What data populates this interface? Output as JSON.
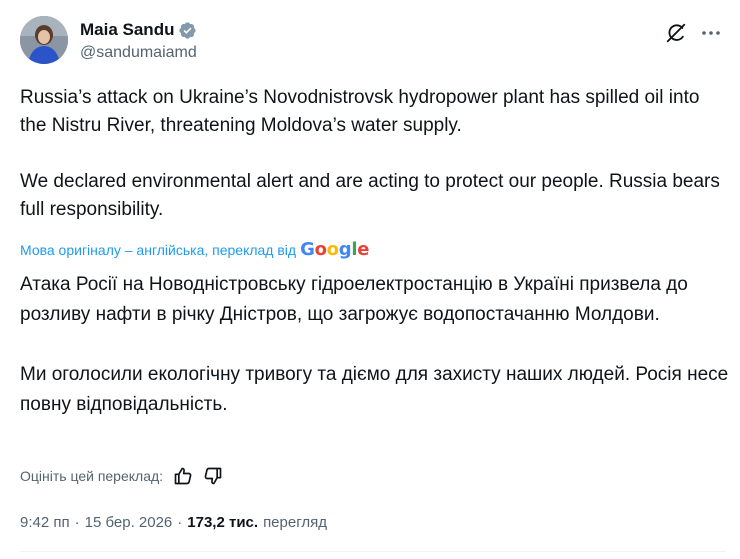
{
  "author": {
    "display_name": "Maia Sandu",
    "handle": "@sandumaiamd",
    "verified": true
  },
  "tweet": {
    "paragraphs": [
      "Russia’s attack on Ukraine’s Novodnistrovsk hydropower plant has spilled oil into the Nistru River, threatening Moldova’s water supply.",
      "We declared environmental alert and are acting to protect our people. Russia bears full responsibility."
    ]
  },
  "translation": {
    "note": "Мова оригіналу – англійська, переклад від",
    "provider": "Google",
    "paragraphs": [
      "Атака Росії на Новодністровську гідроелектростанцію в Україні призвела до розливу нафти в річку Дністров, що загрожує водопостачанню Молдови.",
      "Ми оголосили екологічну тривогу та діємо для захисту наших людей. Росія несе повну відповідальність."
    ],
    "rate_label": "Оцініть цей переклад:"
  },
  "meta": {
    "time": "9:42 пп",
    "separator": "·",
    "date": "15 бер. 2026",
    "views_count": "173,2 тис.",
    "views_label": "перегляд"
  },
  "icons": {
    "verified": "verified-badge-icon",
    "grok": "grok-icon",
    "more": "more-options-icon",
    "thumb_up": "thumbs-up-icon",
    "thumb_down": "thumbs-down-icon"
  },
  "colors": {
    "accent": "#1d9bf0",
    "text": "#0f1419",
    "secondary": "#536471"
  }
}
